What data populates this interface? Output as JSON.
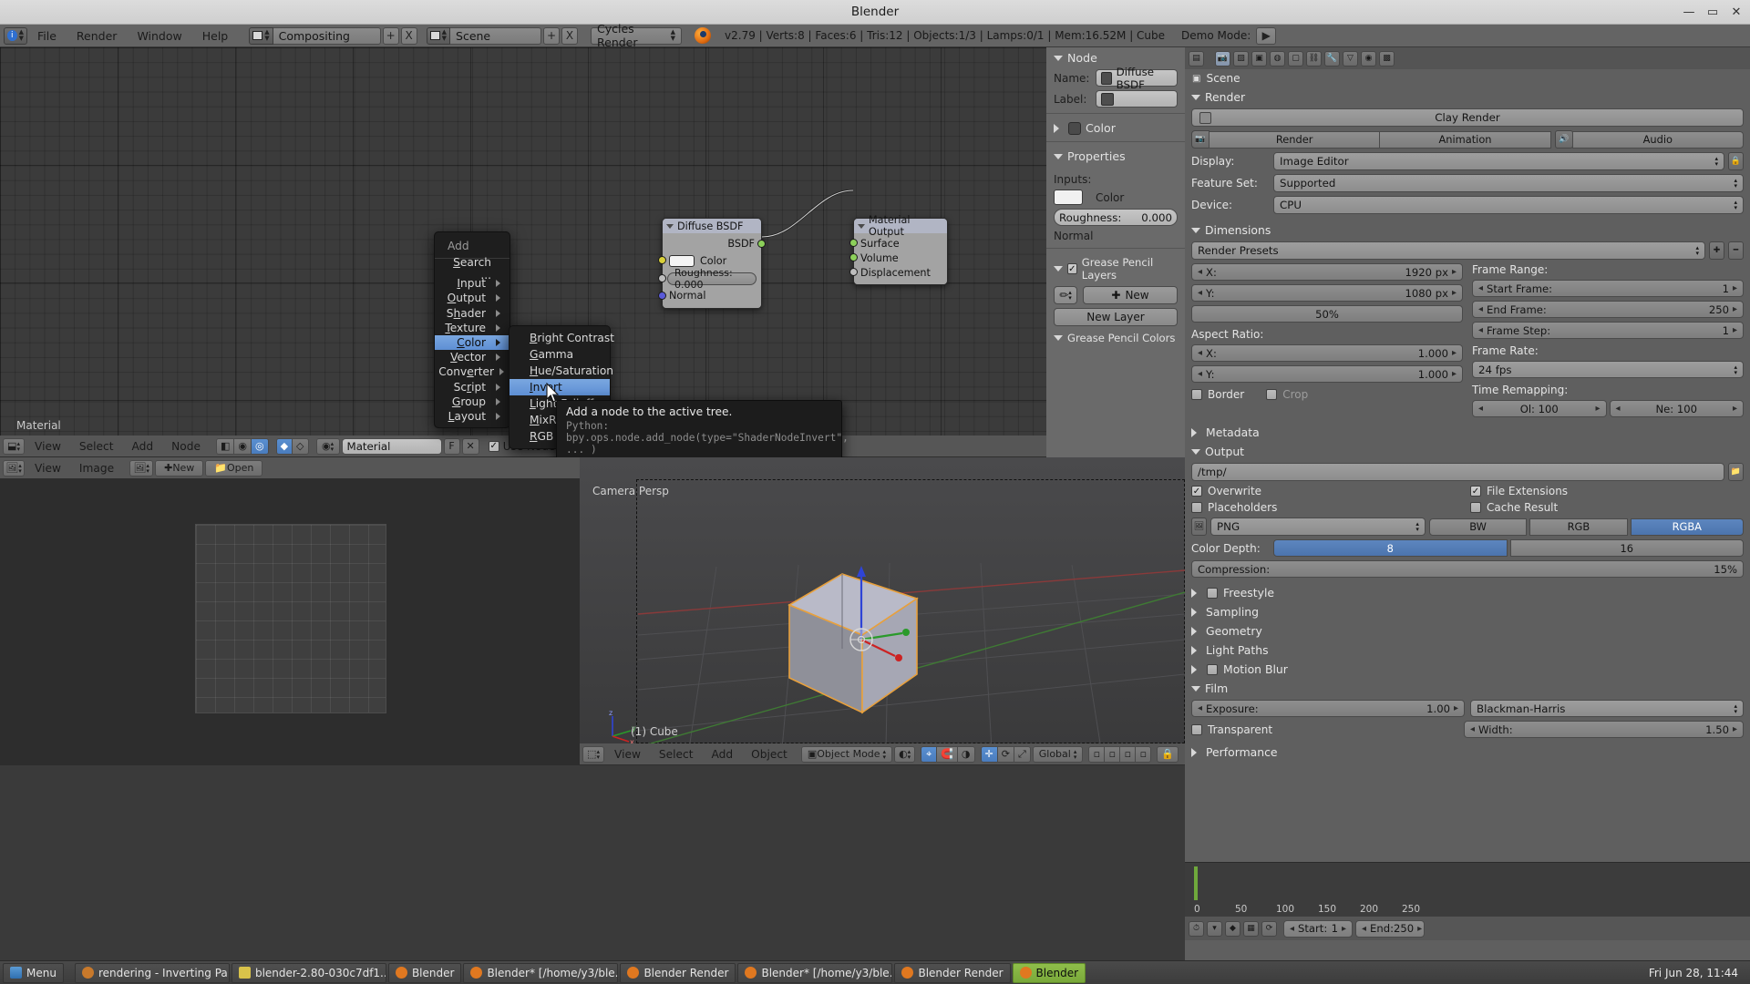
{
  "window": {
    "title": "Blender",
    "minimize": "—",
    "maximize": "▭",
    "close": "✕"
  },
  "topbar": {
    "menus": [
      "File",
      "Render",
      "Window",
      "Help"
    ],
    "screen_layout": "Compositing",
    "scene": "Scene",
    "engine": "Cycles Render",
    "stats": "v2.79 | Verts:8 | Faces:6 | Tris:12 | Objects:1/3 | Lamps:0/1 | Mem:16.52M | Cube",
    "demo_mode_label": "Demo Mode:",
    "add_label": "+",
    "close_label": "X",
    "play_label": "▶"
  },
  "node_editor": {
    "header": {
      "menus": [
        "View",
        "Select",
        "Add",
        "Node"
      ],
      "datablock": "Material",
      "f_label": "F",
      "use_nodes": "Use Nodes",
      "snap_label": "⌖"
    },
    "corner_label": "Material",
    "nodes": [
      {
        "title": "Diffuse BSDF",
        "outputs": [
          {
            "name": "BSDF",
            "color": "#8cd05a"
          }
        ],
        "color_row": "Color",
        "roughness_row": "Roughness:  0.000",
        "normal_row": "Normal",
        "color_sock": "#d9d03a",
        "rough_sock": "#9e9e9e",
        "normal_sock": "#5a5ad9"
      },
      {
        "title": "Material Output",
        "inputs": [
          {
            "name": "Surface",
            "color": "#8cd05a"
          },
          {
            "name": "Volume",
            "color": "#8cd05a"
          },
          {
            "name": "Displacement",
            "color": "#9e9e9e"
          }
        ]
      }
    ]
  },
  "add_menu": {
    "title": "Add",
    "items": [
      {
        "label": "Search ...",
        "accel": "S",
        "sub": false
      },
      {
        "label": "Input",
        "accel": "I",
        "sub": true
      },
      {
        "label": "Output",
        "accel": "O",
        "sub": true
      },
      {
        "label": "Shader",
        "accel": "h",
        "sub": true
      },
      {
        "label": "Texture",
        "accel": "T",
        "sub": true
      },
      {
        "label": "Color",
        "accel": "C",
        "sub": true,
        "selected": true
      },
      {
        "label": "Vector",
        "accel": "V",
        "sub": true
      },
      {
        "label": "Converter",
        "accel": "e",
        "sub": true
      },
      {
        "label": "Script",
        "accel": "r",
        "sub": true
      },
      {
        "label": "Group",
        "accel": "G",
        "sub": true
      },
      {
        "label": "Layout",
        "accel": "L",
        "sub": true
      }
    ],
    "submenu": {
      "items": [
        {
          "label": "Bright Contrast",
          "accel": "B"
        },
        {
          "label": "Gamma",
          "accel": "G"
        },
        {
          "label": "Hue/Saturation",
          "accel": "H"
        },
        {
          "label": "Invert",
          "accel": "I",
          "selected": true
        },
        {
          "label": "Light Falloff",
          "accel": "L"
        },
        {
          "label": "MixRGB",
          "accel": "M"
        },
        {
          "label": "RGB Curves",
          "accel": "R"
        }
      ]
    },
    "tooltip": {
      "line1": "Add a node to the active tree.",
      "line2": "Python: bpy.ops.node.add_node(type=\"ShaderNodeInvert\", ... )"
    }
  },
  "node_properties": {
    "node_section": "Node",
    "name_label": "Name:",
    "name_value": "Diffuse BSDF",
    "label_label": "Label:",
    "label_value": "",
    "color_section": "Color",
    "properties_section": "Properties",
    "inputs_label": "Inputs:",
    "input_color": "Color",
    "input_roughness_label": "Roughness:",
    "input_roughness_value": "0.000",
    "input_normal": "Normal",
    "gp_layers_section": "Grease Pencil Layers",
    "gp_new": "New",
    "gp_new_layer": "New Layer",
    "gp_colors_section": "Grease Pencil Colors"
  },
  "render_properties": {
    "breadcrumb": "Scene",
    "render_section": "Render",
    "clay_render": "Clay Render",
    "render_btn": "Render",
    "animation_btn": "Animation",
    "audio_btn": "Audio",
    "display_label": "Display:",
    "display_value": "Image Editor",
    "feature_set_label": "Feature Set:",
    "feature_set_value": "Supported",
    "device_label": "Device:",
    "device_value": "CPU",
    "dimensions_section": "Dimensions",
    "render_presets": "Render Presets",
    "res_x_label": "X:",
    "res_x_value": "1920 px",
    "res_y_label": "Y:",
    "res_y_value": "1080 px",
    "res_percent": "50%",
    "frame_range_label": "Frame Range:",
    "start_frame_label": "Start Frame:",
    "start_frame_value": "1",
    "end_frame_label": "End Frame:",
    "end_frame_value": "250",
    "frame_step_label": "Frame Step:",
    "frame_step_value": "1",
    "aspect_label": "Aspect Ratio:",
    "aspect_x_label": "X:",
    "aspect_x_value": "1.000",
    "aspect_y_label": "Y:",
    "aspect_y_value": "1.000",
    "frame_rate_label": "Frame Rate:",
    "frame_rate_value": "24 fps",
    "time_remap_label": "Time Remapping:",
    "old_label": "Ol: 100",
    "new_label": "Ne: 100",
    "border_label": "Border",
    "crop_label": "Crop",
    "metadata_section": "Metadata",
    "output_section": "Output",
    "output_path": "/tmp/",
    "overwrite": "Overwrite",
    "file_extensions": "File Extensions",
    "placeholders": "Placeholders",
    "cache_result": "Cache Result",
    "format_value": "PNG",
    "bw": "BW",
    "rgb": "RGB",
    "rgba": "RGBA",
    "color_depth_label": "Color Depth:",
    "depth_8": "8",
    "depth_16": "16",
    "compression_label": "Compression:",
    "compression_value": "15%",
    "freestyle_section": "Freestyle",
    "sampling_section": "Sampling",
    "geometry_section": "Geometry",
    "light_paths_section": "Light Paths",
    "motion_blur_section": "Motion Blur",
    "film_section": "Film",
    "exposure_label": "Exposure:",
    "exposure_value": "1.00",
    "filter_value": "Blackman-Harris",
    "transparent_label": "Transparent",
    "width_label": "Width:",
    "width_value": "1.50",
    "performance_section": "Performance",
    "timeline_start_label": "Start:",
    "timeline_start_value": "1",
    "timeline_end_label": "End:",
    "timeline_end_value": "250",
    "current_frame": "1",
    "tl_ticks": [
      "0",
      "50",
      "100",
      "150",
      "200",
      "250"
    ]
  },
  "image_editor": {
    "menus": [
      "View",
      "Image"
    ],
    "new_btn": "New",
    "open_btn": "Open"
  },
  "view3d": {
    "menus": [
      "View",
      "Select",
      "Add",
      "Object"
    ],
    "mode": "Object Mode",
    "shading": "Global",
    "camera_label": "Camera Persp",
    "object_label": "(1) Cube",
    "axis_x": "x",
    "axis_y": "y",
    "axis_z": "z"
  },
  "taskbar": {
    "menu_label": "Menu",
    "items": [
      {
        "label": "rendering - Inverting Pa...",
        "color": "#c8792b"
      },
      {
        "label": "blender-2.80-030c7df1...",
        "color": "#d8c24a"
      },
      {
        "label": "Blender",
        "color": "#e07820"
      },
      {
        "label": "Blender* [/home/y3/ble...",
        "color": "#e07820"
      },
      {
        "label": "Blender Render",
        "color": "#e07820"
      },
      {
        "label": "Blender* [/home/y3/ble...",
        "color": "#e07820"
      },
      {
        "label": "Blender Render",
        "color": "#e07820"
      },
      {
        "label": "Blender",
        "color": "#3d6a22",
        "active": true
      }
    ],
    "clock": "Fri Jun 28, 11:44"
  }
}
